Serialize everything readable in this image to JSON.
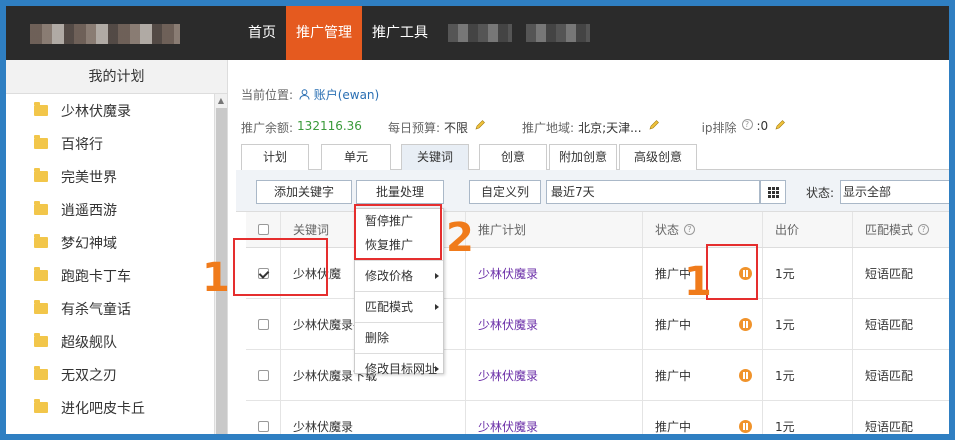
{
  "topnav": {
    "items": [
      {
        "label": "首页",
        "active": false
      },
      {
        "label": "推广管理",
        "active": true
      },
      {
        "label": "推广工具",
        "active": false
      }
    ]
  },
  "sidebar": {
    "title": "我的计划",
    "items": [
      "少林伏魔录",
      "百将行",
      "完美世界",
      "逍遥西游",
      "梦幻神域",
      "跑跑卡丁车",
      "有杀气童话",
      "超级舰队",
      "无双之刃",
      "进化吧皮卡丘"
    ]
  },
  "breadcrumb": {
    "prefix": "当前位置:",
    "account": "账户(ewan)"
  },
  "info": {
    "balance_label": "推广余额:",
    "balance_value": "132116.36",
    "budget_label": "每日预算:",
    "budget_value": "不限",
    "region_label": "推广地域:",
    "region_value": "北京;天津...",
    "ip_label": "ip排除",
    "ip_value": ":0"
  },
  "tabs": [
    "计划",
    "单元",
    "关键词",
    "创意",
    "附加创意",
    "高级创意"
  ],
  "active_tab": "关键词",
  "toolbar": {
    "add_keyword": "添加关键字",
    "batch": "批量处理",
    "custom_columns": "自定义列",
    "date_range": "最近7天",
    "status_label": "状态:",
    "status_value": "显示全部"
  },
  "table": {
    "headers": [
      "关键词",
      "推广计划",
      "状态",
      "出价",
      "匹配模式"
    ],
    "rows": [
      {
        "checked": true,
        "keyword": "少林伏魔",
        "plan": "少林伏魔录",
        "status": "推广中",
        "bid": "1元",
        "match": "短语匹配"
      },
      {
        "checked": false,
        "keyword": "少林伏魔录手",
        "plan": "少林伏魔录",
        "status": "推广中",
        "bid": "1元",
        "match": "短语匹配"
      },
      {
        "checked": false,
        "keyword": "少林伏魔录下载",
        "plan": "少林伏魔录",
        "status": "推广中",
        "bid": "1元",
        "match": "短语匹配"
      },
      {
        "checked": false,
        "keyword": "少林伏魔录",
        "plan": "少林伏魔录",
        "status": "推广中",
        "bid": "1元",
        "match": "短语匹配"
      }
    ]
  },
  "dropdown": {
    "items": [
      "暂停推广",
      "恢复推广",
      "修改价格",
      "匹配模式",
      "删除",
      "修改目标网址"
    ]
  },
  "annotations": {
    "one": "1",
    "two": "2"
  },
  "colors": {
    "topbar": "#2b2b2b",
    "nav_active": "#e55a1f",
    "annotation": "#f07b1b",
    "highlight_box": "#e52e2e",
    "pause_icon": "#f0932b",
    "plan_link": "#6b2fa8"
  }
}
